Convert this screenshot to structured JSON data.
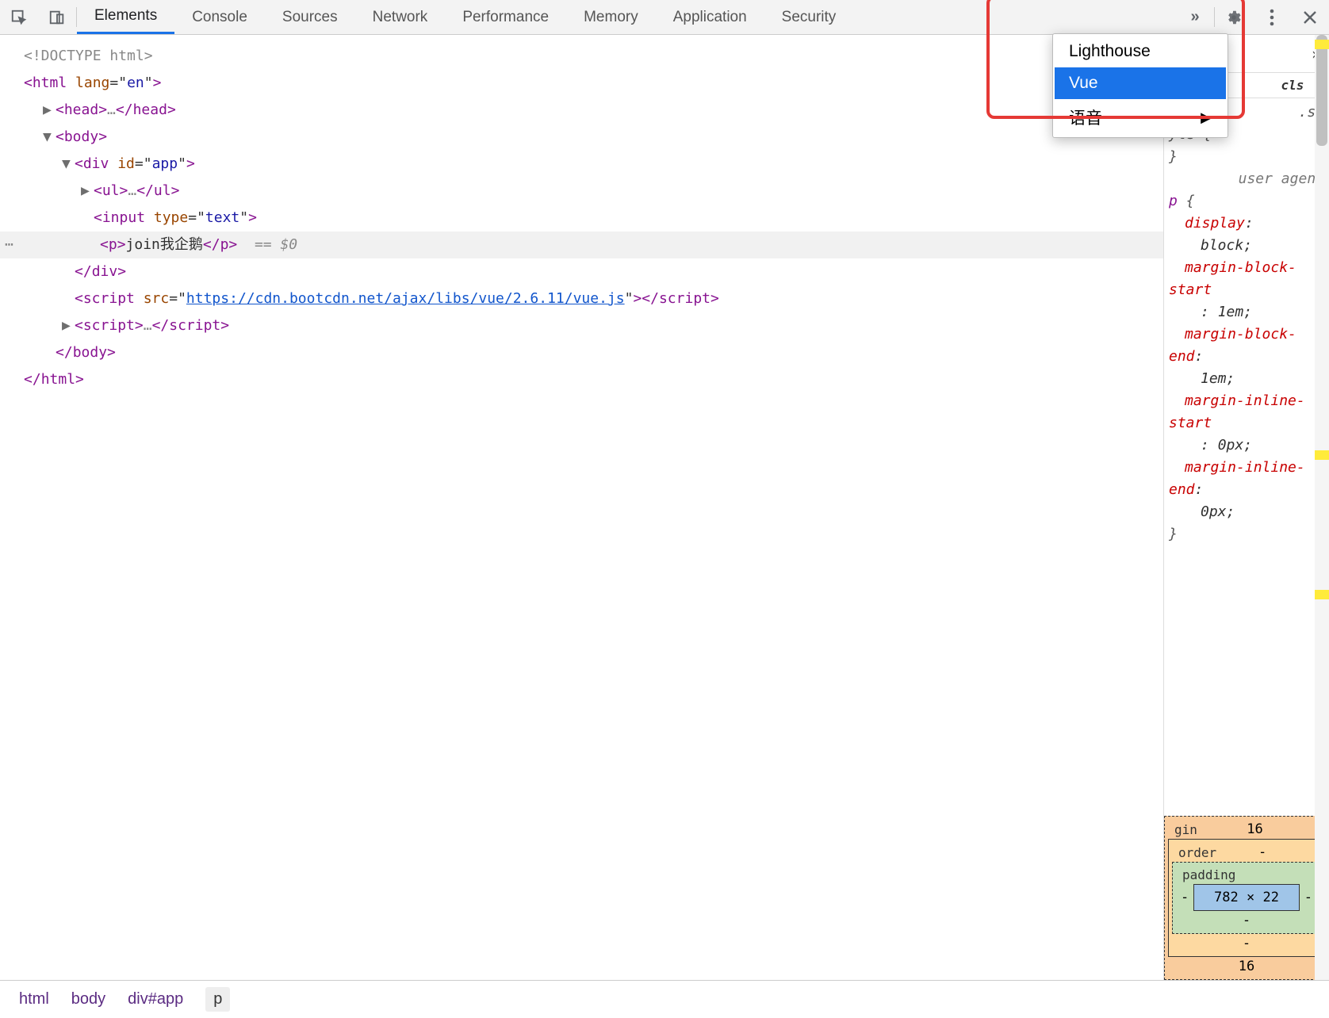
{
  "tabs": [
    "Elements",
    "Console",
    "Sources",
    "Network",
    "Performance",
    "Memory",
    "Application",
    "Security"
  ],
  "active_tab": "Elements",
  "overflow_menu": {
    "items": [
      {
        "label": "Lighthouse",
        "selected": false
      },
      {
        "label": "Vue",
        "selected": true
      },
      {
        "label": "语音",
        "selected": false,
        "submenu": true
      }
    ]
  },
  "dom": {
    "doctype": "<!DOCTYPE html>",
    "html_open": {
      "tag": "html",
      "attr": "lang",
      "val": "en"
    },
    "head": {
      "tag": "head"
    },
    "body": {
      "tag": "body"
    },
    "div": {
      "tag": "div",
      "attr": "id",
      "val": "app"
    },
    "ul": {
      "tag": "ul"
    },
    "input": {
      "tag": "input",
      "attr": "type",
      "val": "text"
    },
    "p": {
      "tag": "p",
      "text": "join我企鹅"
    },
    "selected_marker": "== $0",
    "script1": {
      "tag": "script",
      "attr": "src",
      "val": "https://cdn.bootcdn.net/ajax/libs/vue/2.6.11/vue.js"
    },
    "script2": {
      "tag": "script"
    }
  },
  "styles_pane": {
    "toolbar": {
      "cls_pill": "cls",
      "plus": "+"
    },
    "frag_top": {
      "suffix": ".st",
      "line2": "yle {",
      "line3": "}"
    },
    "ua_label": "user agen…",
    "selector": "p",
    "decls": [
      {
        "prop": "display",
        "val": "block"
      },
      {
        "prop": "margin-block-start",
        "val": "1em"
      },
      {
        "prop": "margin-block-end",
        "val": "1em"
      },
      {
        "prop": "margin-inline-start",
        "val": "0px"
      },
      {
        "prop": "margin-inline-end",
        "val": "0px"
      }
    ],
    "brace_open": "{",
    "brace_close": "}"
  },
  "box_model": {
    "margin": {
      "label": "gin",
      "top": "16",
      "bottom": "16",
      "left": "-",
      "right": "-"
    },
    "border": {
      "label": "order",
      "top": "-",
      "bottom": "-",
      "left": "-",
      "right": "-"
    },
    "padding": {
      "label": "padding",
      "top": "",
      "bottom": "-",
      "left": "-",
      "right": "-"
    },
    "content": "782 × 22"
  },
  "crumbs": [
    "html",
    "body",
    "div#app",
    "p"
  ]
}
